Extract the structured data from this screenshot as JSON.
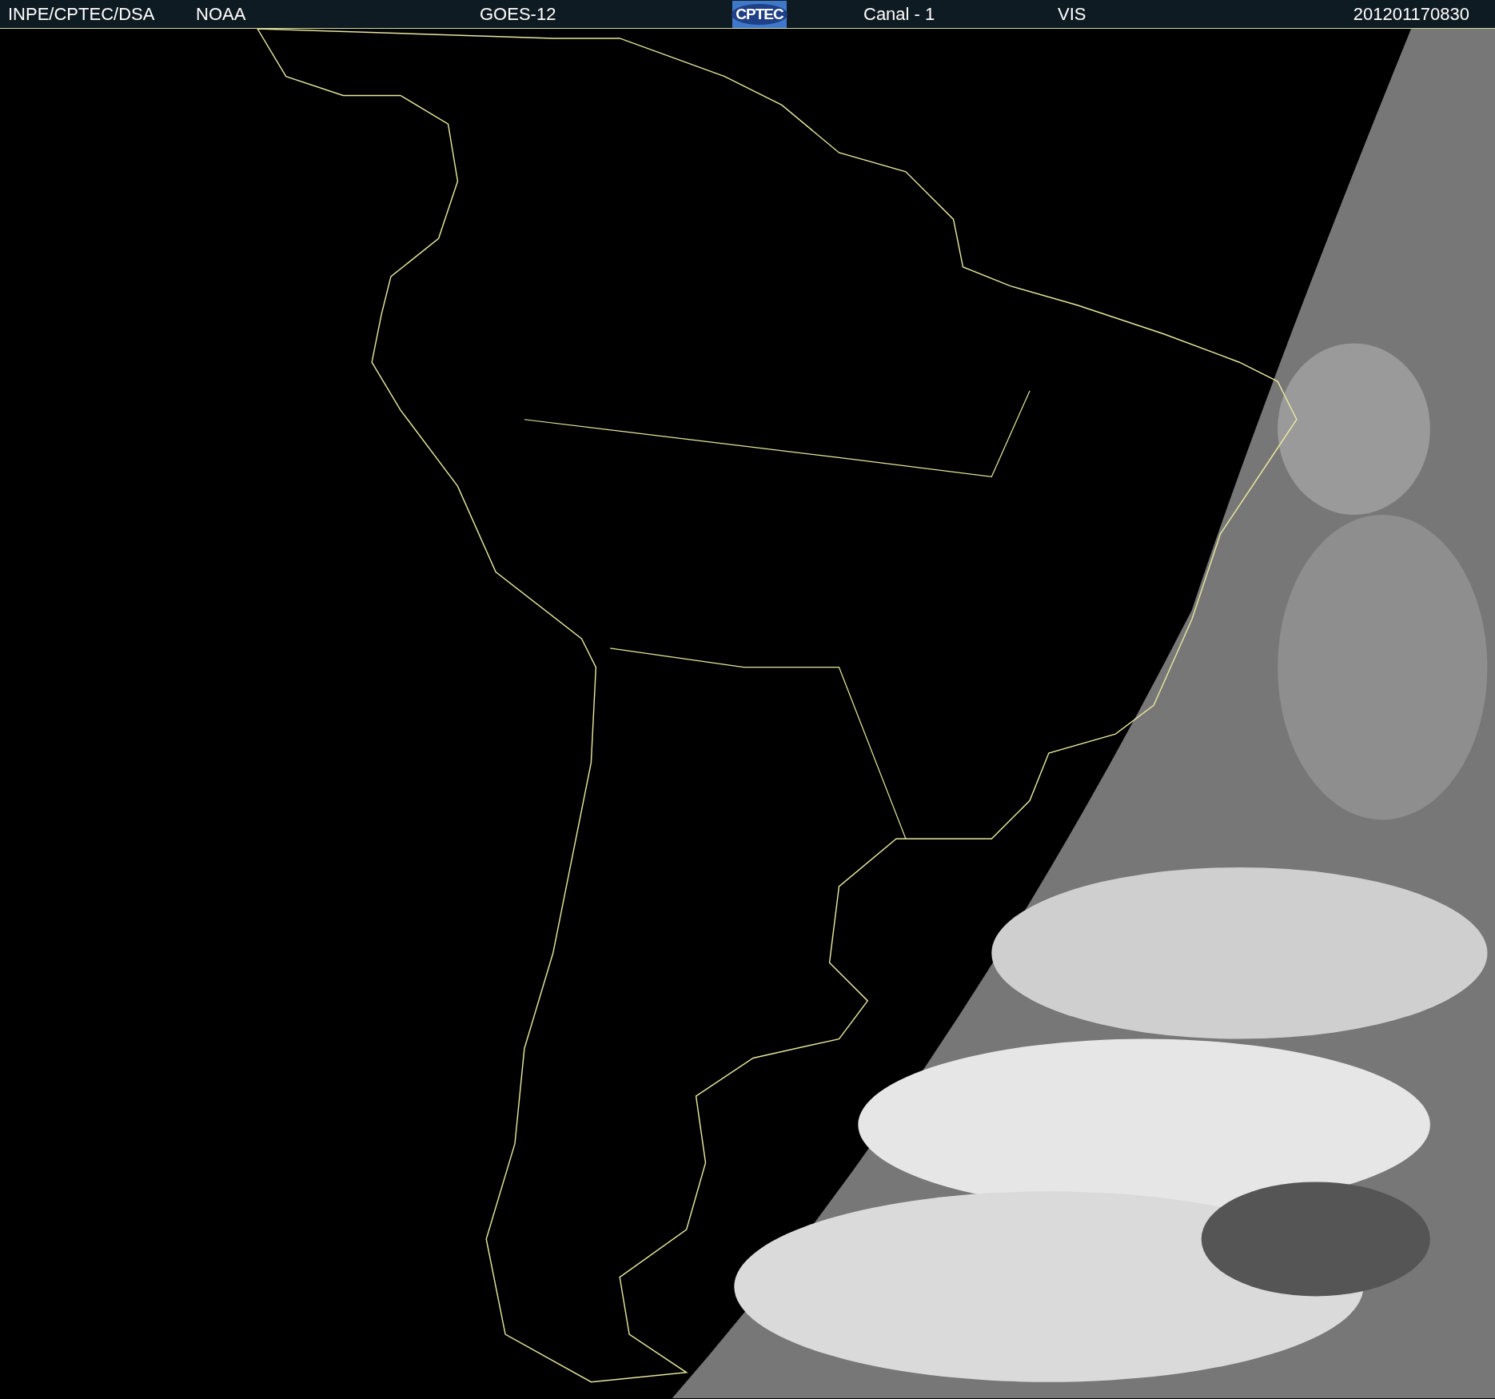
{
  "header": {
    "items": [
      {
        "kind": "text",
        "text": "INPE/CPTEC/DSA"
      },
      {
        "kind": "text",
        "text": "NOAA"
      },
      {
        "kind": "text",
        "text": "GOES-12"
      },
      {
        "kind": "logo",
        "text": "CPTEC"
      },
      {
        "kind": "text",
        "text": "Canal - 1"
      },
      {
        "kind": "text",
        "text": "VIS"
      },
      {
        "kind": "text",
        "text": "201201170830"
      }
    ]
  }
}
